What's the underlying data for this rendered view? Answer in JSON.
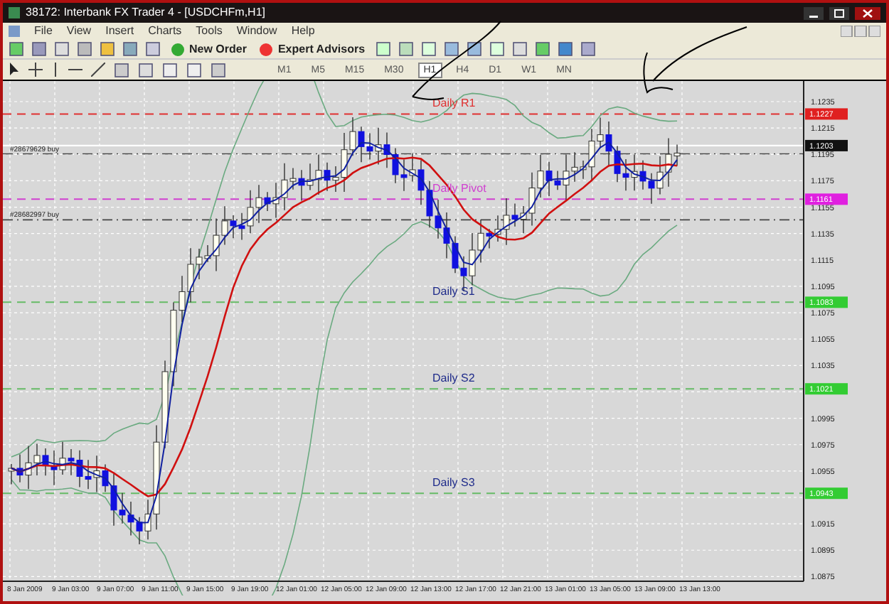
{
  "window": {
    "title": "38172: Interbank FX Trader 4 - [USDCHFm,H1]"
  },
  "menu": [
    "File",
    "View",
    "Insert",
    "Charts",
    "Tools",
    "Window",
    "Help"
  ],
  "toolbar": {
    "buttons": [
      {
        "label": "New Order",
        "kind": "order"
      },
      {
        "label": "Expert Advisors",
        "kind": "experts"
      }
    ]
  },
  "timeframes": [
    {
      "label": "M1",
      "selected": false
    },
    {
      "label": "M5",
      "selected": false
    },
    {
      "label": "M15",
      "selected": false
    },
    {
      "label": "M30",
      "selected": false
    },
    {
      "label": "H1",
      "selected": true
    },
    {
      "label": "H4",
      "selected": false
    },
    {
      "label": "D1",
      "selected": false
    },
    {
      "label": "W1",
      "selected": false
    },
    {
      "label": "MN",
      "selected": false
    }
  ],
  "chart": {
    "price_ticks": [
      "1.1235",
      "1.1215",
      "1.1195",
      "1.1175",
      "1.1155",
      "1.1135",
      "1.1115",
      "1.1095",
      "1.1075",
      "1.1055",
      "1.1035",
      "1.0995",
      "1.0975",
      "1.0955",
      "1.0915",
      "1.0895",
      "1.0875"
    ],
    "time_labels": [
      "8 Jan 2009",
      "9 Jan 03:00",
      "9 Jan 07:00",
      "9 Jan 11:00",
      "9 Jan 15:00",
      "9 Jan 19:00",
      "12 Jan 01:00",
      "12 Jan 05:00",
      "12 Jan 09:00",
      "12 Jan 13:00",
      "12 Jan 17:00",
      "12 Jan 21:00",
      "13 Jan 01:00",
      "13 Jan 05:00",
      "13 Jan 09:00",
      "13 Jan 13:00"
    ],
    "levels": [
      {
        "label": "Daily R1",
        "kind": "resistance",
        "tag": "1.1227"
      },
      {
        "label": "Daily Pivot",
        "kind": "pivot",
        "tag": "1.1161"
      },
      {
        "label": "Daily S1",
        "kind": "support",
        "tag": "1.1083"
      },
      {
        "label": "Daily S2",
        "kind": "support",
        "tag": "1.1021"
      },
      {
        "label": "Daily S3",
        "kind": "support",
        "tag": "1.0943"
      }
    ],
    "orders": [
      {
        "label": "#28679629 buy"
      },
      {
        "label": "#28682997 buy"
      }
    ],
    "bid_tag": "1.1203"
  }
}
